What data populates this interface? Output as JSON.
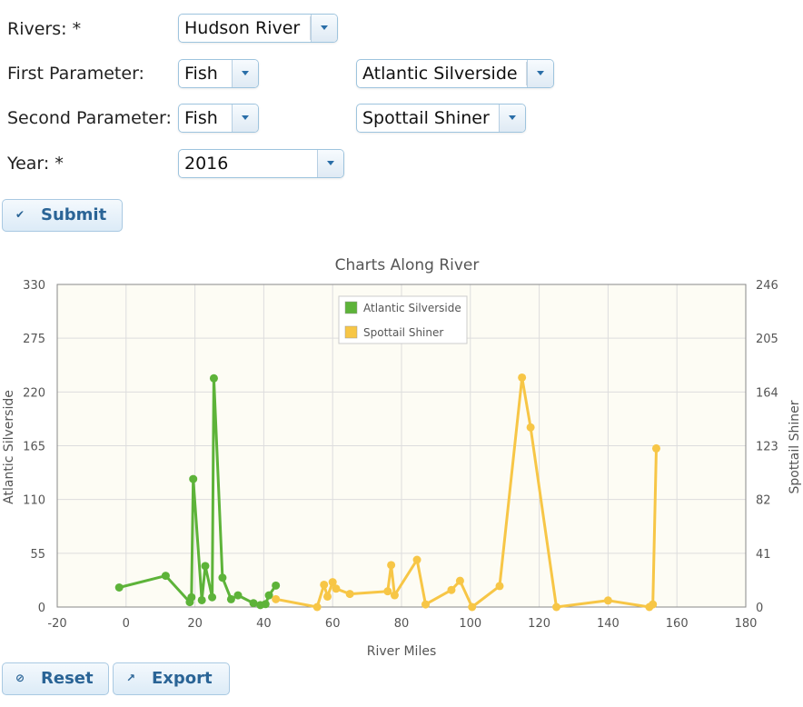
{
  "form": {
    "rivers_label": "Rivers: *",
    "rivers_value": "Hudson River",
    "first_param_label": "First Parameter:",
    "first_param_type": "Fish",
    "first_param_species": "Atlantic Silverside",
    "second_param_label": "Second Parameter:",
    "second_param_type": "Fish",
    "second_param_species": "Spottail Shiner",
    "year_label": "Year: *",
    "year_value": "2016",
    "submit_label": "Submit",
    "reset_label": "Reset",
    "export_label": "Export"
  },
  "chart_data": {
    "type": "line",
    "title": "Charts Along River",
    "xlabel": "River Miles",
    "ylabel_left": "Atlantic Silverside",
    "ylabel_right": "Spottail Shiner",
    "xlim": [
      -20,
      180
    ],
    "xticks": [
      -20,
      0,
      20,
      40,
      60,
      80,
      100,
      120,
      140,
      160,
      180
    ],
    "ylim_left": [
      0,
      330
    ],
    "yticks_left": [
      0,
      55,
      110,
      165,
      220,
      275,
      330
    ],
    "ylim_right": [
      0,
      246
    ],
    "yticks_right": [
      0,
      41,
      82,
      123,
      164,
      205,
      246
    ],
    "grid": true,
    "legend_position": "top-center",
    "series": [
      {
        "name": "Atlantic Silverside",
        "axis": "left",
        "color": "#5db339",
        "x": [
          -2,
          11.5,
          18.5,
          19,
          19.5,
          22,
          23,
          25,
          25.5,
          28,
          30.5,
          32.5,
          37,
          39,
          40.5,
          41.5,
          43.5
        ],
        "y": [
          20,
          32,
          5,
          10,
          131,
          7,
          42,
          10,
          234,
          30,
          8,
          12,
          4,
          2,
          3,
          12,
          22
        ]
      },
      {
        "name": "Spottail Shiner",
        "axis": "right",
        "color": "#f7c646",
        "x": [
          43.5,
          55.5,
          57.5,
          58.5,
          60,
          61,
          65,
          76,
          77,
          78,
          84.5,
          87,
          94.5,
          97,
          100.5,
          108.5,
          115,
          117.5,
          125,
          140,
          152,
          153,
          154
        ],
        "y": [
          6,
          0,
          17,
          8,
          19,
          14,
          10,
          12,
          32,
          9,
          36,
          2,
          13,
          20,
          0,
          16,
          175,
          137,
          0,
          5,
          0,
          2,
          121
        ]
      }
    ]
  }
}
